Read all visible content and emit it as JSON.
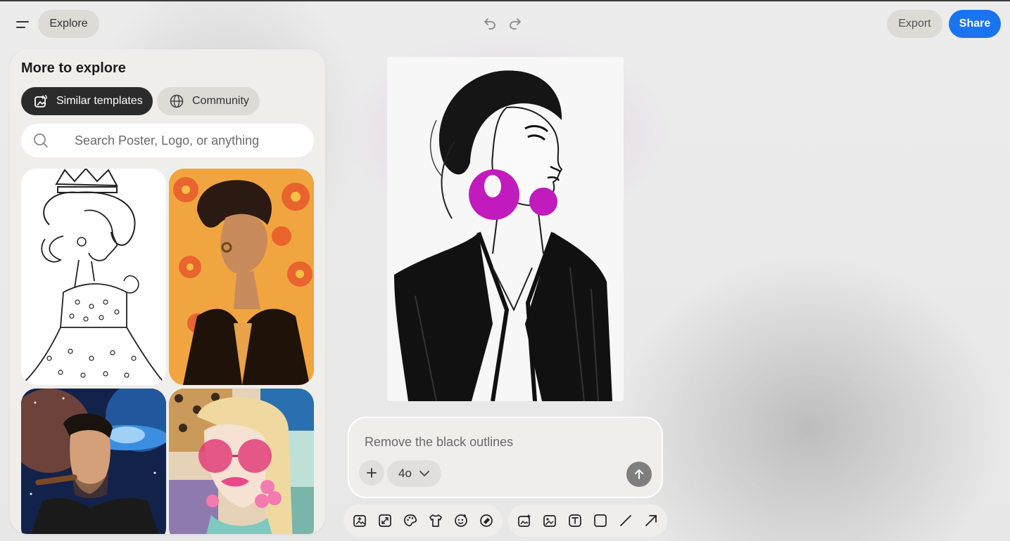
{
  "header": {
    "explore_label": "Explore",
    "export_label": "Export",
    "share_label": "Share"
  },
  "panel": {
    "title": "More to explore",
    "tabs": [
      {
        "label": "Similar templates",
        "active": true
      },
      {
        "label": "Community",
        "active": false
      }
    ],
    "search": {
      "placeholder": "Search Poster, Logo, or anything"
    },
    "templates": [
      {
        "name": "template-coloring-queen"
      },
      {
        "name": "template-floral-woman"
      },
      {
        "name": "template-space-man"
      },
      {
        "name": "template-pop-art-woman"
      }
    ]
  },
  "prompt": {
    "text": "Remove the black outlines",
    "model": "4o"
  },
  "colors": {
    "accent": "#1b74ef",
    "earring": "#c21bbd",
    "panel_bg": "#efeeea",
    "chip_dark": "#2b2b2b"
  },
  "toolbar": {
    "group1": [
      "add-image-icon",
      "expand-icon",
      "palette-icon",
      "shirt-icon",
      "sticker-icon",
      "eraser-icon"
    ],
    "group2": [
      "magic-image-icon",
      "image-edit-icon",
      "text-icon",
      "rectangle-icon",
      "line-icon",
      "arrow-icon"
    ]
  }
}
